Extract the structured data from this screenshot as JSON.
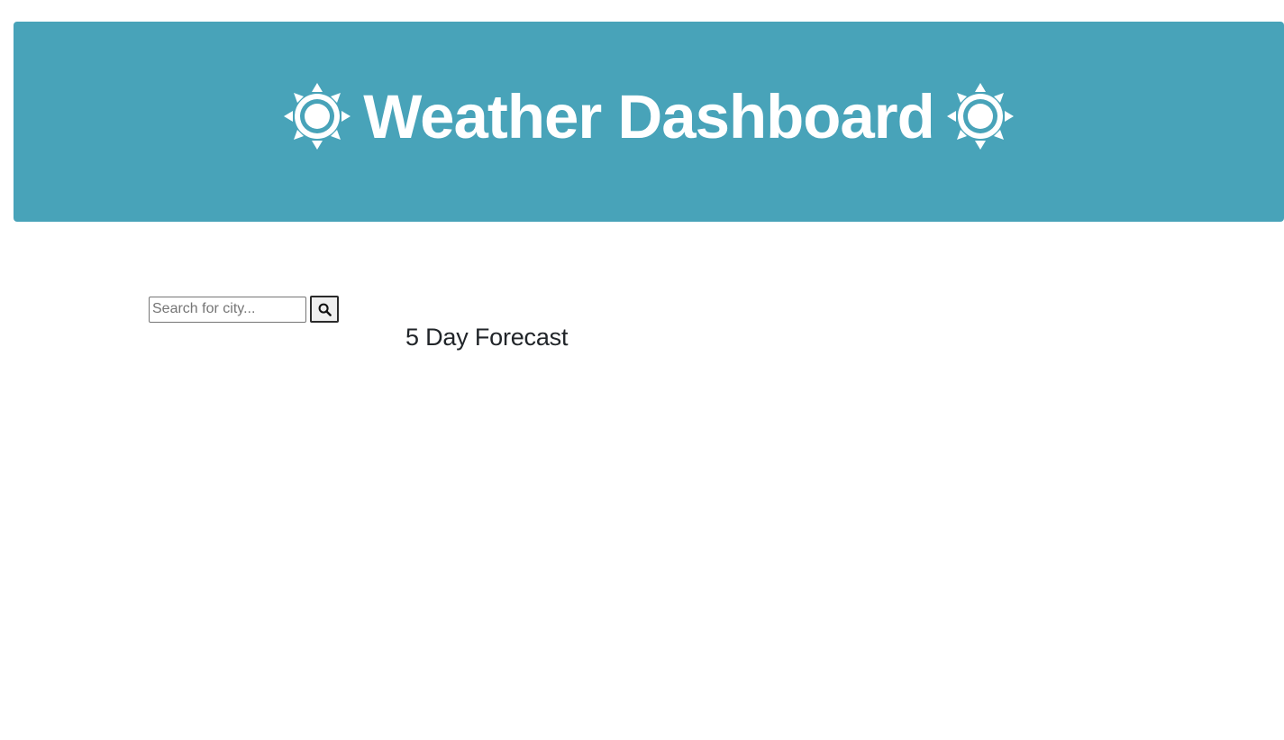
{
  "header": {
    "title": "Weather Dashboard",
    "background_color": "#48a3b9",
    "left_icon": "sun-icon",
    "right_icon": "sun-icon"
  },
  "search": {
    "placeholder": "Search for city...",
    "value": "",
    "button_icon": "search-icon"
  },
  "forecast": {
    "heading": "5 Day Forecast"
  }
}
